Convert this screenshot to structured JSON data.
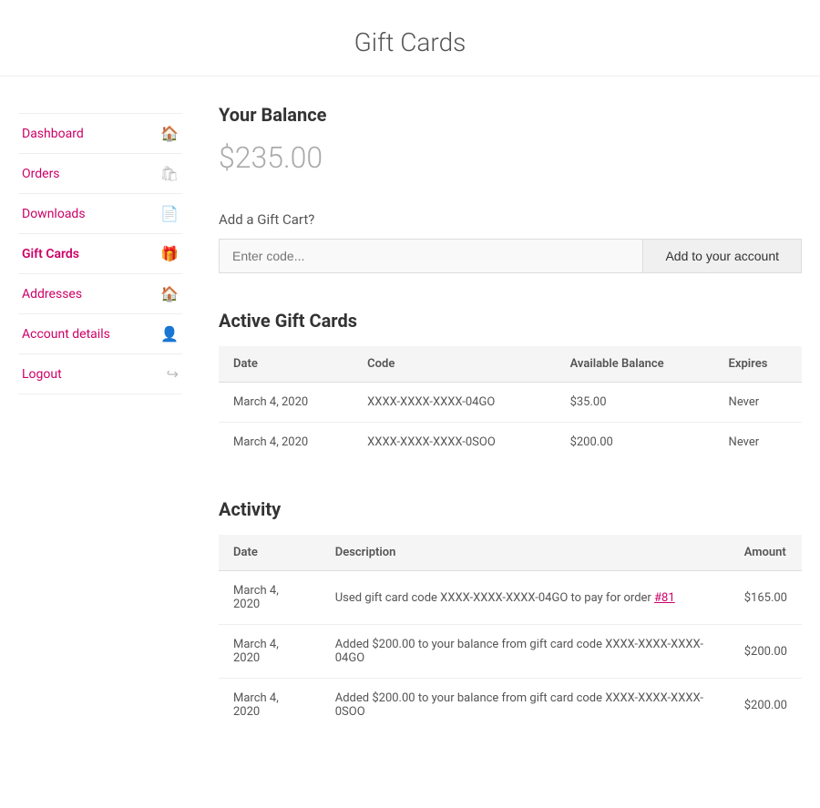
{
  "page": {
    "title": "Gift Cards"
  },
  "sidebar": {
    "items": [
      {
        "id": "dashboard",
        "label": "Dashboard",
        "icon": "🏠",
        "active": false
      },
      {
        "id": "orders",
        "label": "Orders",
        "icon": "🛍",
        "active": false
      },
      {
        "id": "downloads",
        "label": "Downloads",
        "icon": "📄",
        "active": false
      },
      {
        "id": "gift-cards",
        "label": "Gift Cards",
        "icon": "🎁",
        "active": true
      },
      {
        "id": "addresses",
        "label": "Addresses",
        "icon": "🏠",
        "active": false
      },
      {
        "id": "account-details",
        "label": "Account details",
        "icon": "👤",
        "active": false
      },
      {
        "id": "logout",
        "label": "Logout",
        "icon": "↪",
        "active": false
      }
    ]
  },
  "main": {
    "balance_title": "Your Balance",
    "balance_amount": "$235.00",
    "add_gift_label": "Add a Gift Cart?",
    "add_gift_placeholder": "Enter code...",
    "add_gift_button": "Add to your account",
    "active_cards_title": "Active Gift Cards",
    "active_cards_headers": [
      "Date",
      "Code",
      "Available Balance",
      "Expires"
    ],
    "active_cards": [
      {
        "date": "March 4, 2020",
        "code": "XXXX-XXXX-XXXX-04GO",
        "balance": "$35.00",
        "expires": "Never"
      },
      {
        "date": "March 4, 2020",
        "code": "XXXX-XXXX-XXXX-0SOO",
        "balance": "$200.00",
        "expires": "Never"
      }
    ],
    "activity_title": "Activity",
    "activity_headers": [
      "Date",
      "Description",
      "Amount"
    ],
    "activity_rows": [
      {
        "date": "March 4, 2020",
        "description_prefix": "Used gift card code XXXX-XXXX-XXXX-04GO to pay for order ",
        "description_link": "#81",
        "description_suffix": "",
        "amount": "$165.00"
      },
      {
        "date": "March 4, 2020",
        "description_prefix": "Added $200.00 to your balance from gift card code XXXX-XXXX-XXXX-04GO",
        "description_link": "",
        "description_suffix": "",
        "amount": "$200.00"
      },
      {
        "date": "March 4, 2020",
        "description_prefix": "Added $200.00 to your balance from gift card code XXXX-XXXX-XXXX-0SOO",
        "description_link": "",
        "description_suffix": "",
        "amount": "$200.00"
      }
    ]
  }
}
